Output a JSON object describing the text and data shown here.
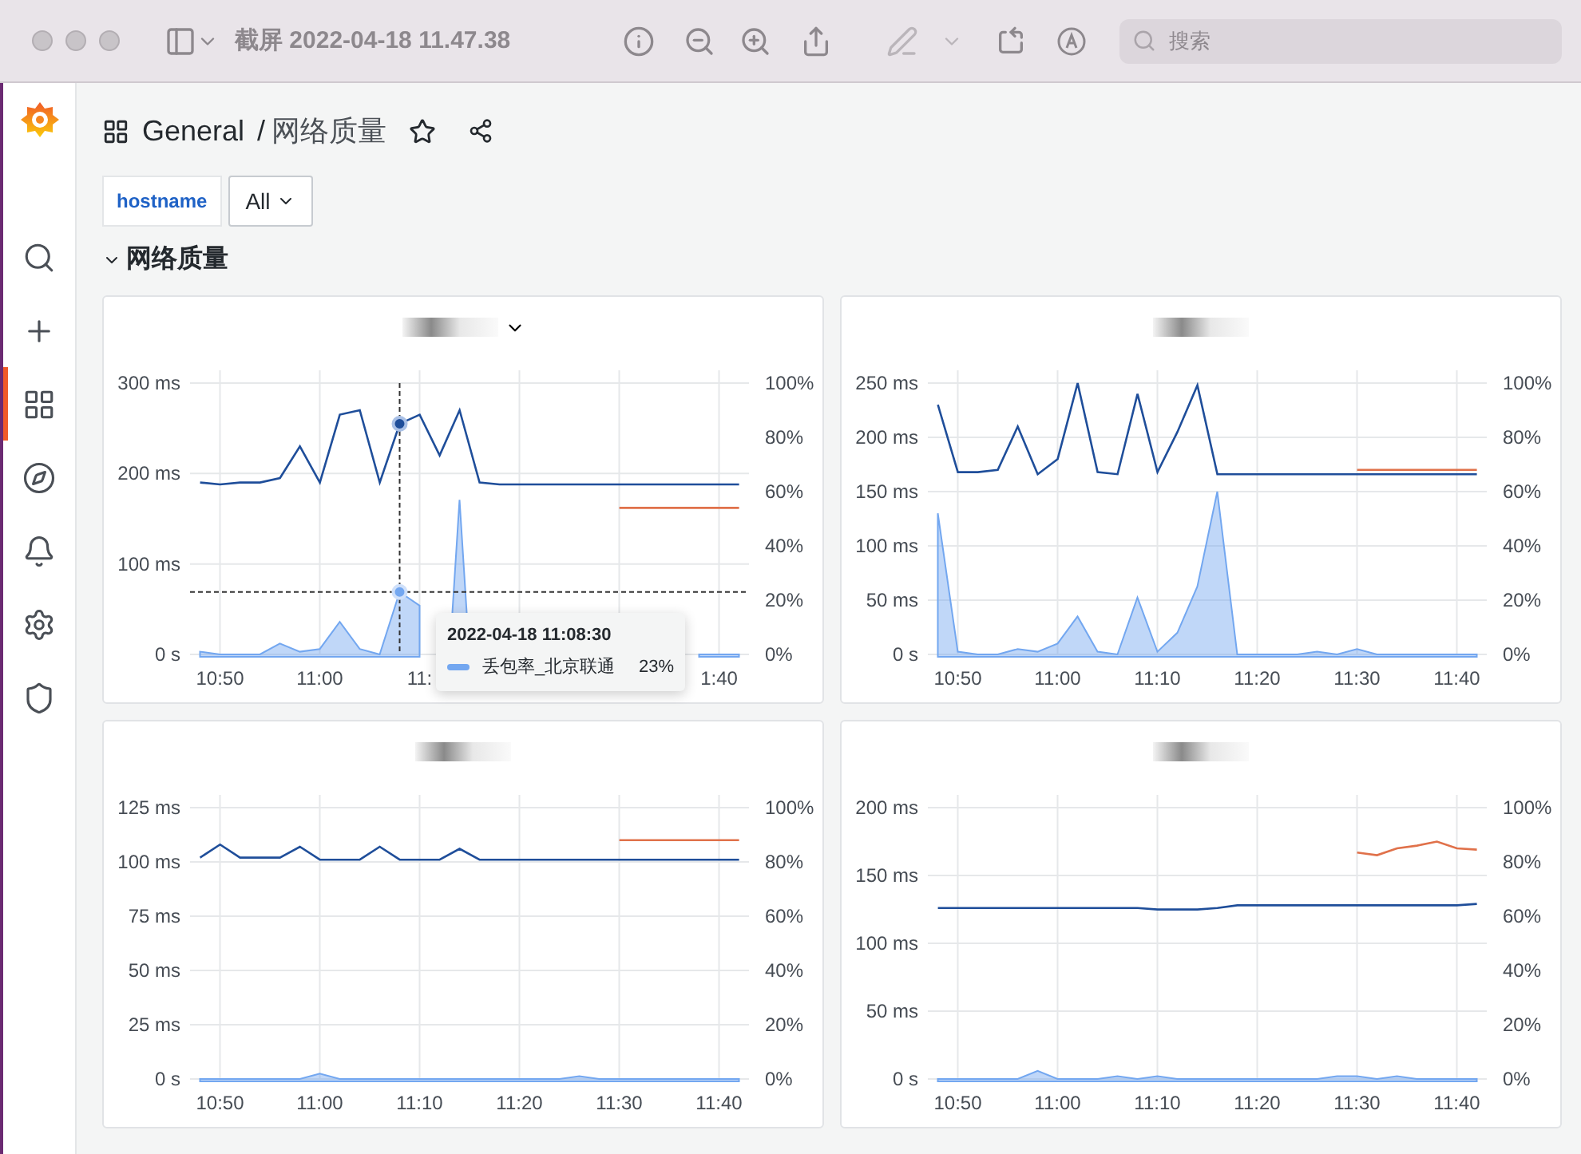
{
  "window": {
    "title": "截屏 2022-04-18 11.47.38",
    "search": {
      "placeholder": "搜索"
    }
  },
  "sidebar": {
    "items": [
      {
        "selected": false
      },
      {
        "selected": false
      },
      {
        "selected": true
      },
      {
        "selected": false
      },
      {
        "selected": false
      },
      {
        "selected": false
      },
      {
        "selected": false
      }
    ]
  },
  "breadcrumb": {
    "folder": "General",
    "separator": "/",
    "dashboard": "网络质量",
    "starred": false
  },
  "variables": [
    {
      "label": "hostname",
      "value": "All"
    }
  ],
  "row": {
    "title": "网络质量",
    "expanded": true
  },
  "panels": [
    {
      "hovered": true,
      "chart_data": {
        "type": "line",
        "x": [
          null,
          "10:50",
          null,
          null,
          null,
          null,
          "11:00",
          null,
          null,
          null,
          null,
          "11:",
          null,
          null,
          null,
          null,
          null,
          null,
          null,
          null,
          null,
          null,
          null,
          null,
          null,
          null,
          "1:40",
          null
        ],
        "ylim": [
          0,
          300
        ],
        "y2lim": [
          0,
          100
        ],
        "grid": true,
        "ref_lines": [
          {
            "axis": "y2",
            "value": 23
          }
        ],
        "yticks": [
          {
            "value": 0,
            "label": "0 s"
          },
          {
            "value": 100,
            "label": "100 ms"
          },
          {
            "value": 200,
            "label": "200 ms"
          },
          {
            "value": 300,
            "label": "300 ms"
          }
        ],
        "y2ticks": [
          {
            "value": 0,
            "label": "0%"
          },
          {
            "value": 20,
            "label": "20%"
          },
          {
            "value": 40,
            "label": "40%"
          },
          {
            "value": 60,
            "label": "60%"
          },
          {
            "value": 80,
            "label": "80%"
          },
          {
            "value": 100,
            "label": "100%"
          }
        ],
        "series": [
          {
            "axis": "y2",
            "type": "area",
            "color": "#73a7f0",
            "values": [
              1,
              0,
              0,
              0,
              4,
              1,
              2,
              12,
              2,
              0,
              23,
              18,
              null,
              57,
              null,
              null,
              null,
              null,
              null,
              null,
              null,
              null,
              null,
              null,
              null,
              0,
              0,
              0
            ]
          },
          {
            "color": "#1f4e9a",
            "values": [
              190,
              188,
              190,
              190,
              195,
              230,
              190,
              265,
              270,
              190,
              255,
              265,
              220,
              270,
              190,
              188,
              188,
              188,
              188,
              188,
              188,
              188,
              188,
              188,
              188,
              188,
              188,
              188
            ]
          },
          {
            "color": "#e0714a",
            "values": [
              null,
              null,
              null,
              null,
              null,
              null,
              null,
              null,
              null,
              null,
              null,
              null,
              null,
              null,
              null,
              null,
              null,
              null,
              null,
              null,
              null,
              162,
              162,
              162,
              162,
              162,
              162,
              162
            ]
          }
        ]
      },
      "tooltip": {
        "time": "2022-04-18 11:08:30",
        "items": [
          {
            "name": "丢包率_北京联通",
            "value": "23%",
            "color": "#73a7f0"
          }
        ]
      }
    },
    {
      "hovered": false,
      "chart_data": {
        "type": "line",
        "x": [
          null,
          "10:50",
          null,
          null,
          null,
          null,
          "11:00",
          null,
          null,
          null,
          null,
          "11:10",
          null,
          null,
          null,
          null,
          "11:20",
          null,
          null,
          null,
          null,
          "11:30",
          null,
          null,
          null,
          null,
          "11:40",
          null
        ],
        "ylim": [
          0,
          250
        ],
        "y2lim": [
          0,
          100
        ],
        "grid": true,
        "yticks": [
          {
            "value": 0,
            "label": "0 s"
          },
          {
            "value": 50,
            "label": "50 ms"
          },
          {
            "value": 100,
            "label": "100 ms"
          },
          {
            "value": 150,
            "label": "150 ms"
          },
          {
            "value": 200,
            "label": "200 ms"
          },
          {
            "value": 250,
            "label": "250 ms"
          }
        ],
        "y2ticks": [
          {
            "value": 0,
            "label": "0%"
          },
          {
            "value": 20,
            "label": "20%"
          },
          {
            "value": 40,
            "label": "40%"
          },
          {
            "value": 60,
            "label": "60%"
          },
          {
            "value": 80,
            "label": "80%"
          },
          {
            "value": 100,
            "label": "100%"
          }
        ],
        "series": [
          {
            "axis": "y2",
            "type": "area",
            "color": "#73a7f0",
            "values": [
              52,
              1,
              0,
              0,
              2,
              1,
              4,
              14,
              1,
              0,
              21,
              1,
              8,
              25,
              60,
              0,
              0,
              0,
              0,
              1,
              0,
              2,
              0,
              0,
              0,
              0,
              0,
              0
            ]
          },
          {
            "color": "#1f4e9a",
            "values": [
              230,
              168,
              168,
              170,
              210,
              166,
              180,
              250,
              168,
              166,
              240,
              168,
              205,
              248,
              166,
              166,
              166,
              166,
              166,
              166,
              166,
              166,
              166,
              166,
              166,
              166,
              166,
              166
            ]
          },
          {
            "color": "#e0714a",
            "values": [
              null,
              null,
              null,
              null,
              null,
              null,
              null,
              null,
              null,
              null,
              null,
              null,
              null,
              null,
              null,
              null,
              null,
              null,
              null,
              null,
              null,
              170,
              170,
              170,
              170,
              170,
              170,
              170
            ]
          }
        ]
      }
    },
    {
      "hovered": false,
      "chart_data": {
        "type": "line",
        "x": [
          null,
          "10:50",
          null,
          null,
          null,
          null,
          "11:00",
          null,
          null,
          null,
          null,
          "11:10",
          null,
          null,
          null,
          null,
          "11:20",
          null,
          null,
          null,
          null,
          "11:30",
          null,
          null,
          null,
          null,
          "11:40",
          null
        ],
        "ylim": [
          0,
          125
        ],
        "y2lim": [
          0,
          100
        ],
        "grid": true,
        "yticks": [
          {
            "value": 0,
            "label": "0 s"
          },
          {
            "value": 25,
            "label": "25 ms"
          },
          {
            "value": 50,
            "label": "50 ms"
          },
          {
            "value": 75,
            "label": "75 ms"
          },
          {
            "value": 100,
            "label": "100 ms"
          },
          {
            "value": 125,
            "label": "125 ms"
          }
        ],
        "y2ticks": [
          {
            "value": 0,
            "label": "0%"
          },
          {
            "value": 20,
            "label": "20%"
          },
          {
            "value": 40,
            "label": "40%"
          },
          {
            "value": 60,
            "label": "60%"
          },
          {
            "value": 80,
            "label": "80%"
          },
          {
            "value": 100,
            "label": "100%"
          }
        ],
        "series": [
          {
            "axis": "y2",
            "type": "area",
            "color": "#73a7f0",
            "values": [
              0,
              0,
              0,
              0,
              0,
              0,
              2,
              0,
              0,
              0,
              0,
              0,
              0,
              0,
              0,
              0,
              0,
              0,
              0,
              1,
              0,
              0,
              0,
              0,
              0,
              0,
              0,
              0
            ]
          },
          {
            "color": "#1f4e9a",
            "values": [
              102,
              108,
              102,
              102,
              102,
              107,
              101,
              101,
              101,
              107,
              101,
              101,
              101,
              106,
              101,
              101,
              101,
              101,
              101,
              101,
              101,
              101,
              101,
              101,
              101,
              101,
              101,
              101
            ]
          },
          {
            "color": "#e0714a",
            "values": [
              null,
              null,
              null,
              null,
              null,
              null,
              null,
              null,
              null,
              null,
              null,
              null,
              null,
              null,
              null,
              null,
              null,
              null,
              null,
              null,
              null,
              110,
              110,
              110,
              110,
              110,
              110,
              110
            ]
          }
        ]
      }
    },
    {
      "hovered": false,
      "chart_data": {
        "type": "line",
        "x": [
          null,
          "10:50",
          null,
          null,
          null,
          null,
          "11:00",
          null,
          null,
          null,
          null,
          "11:10",
          null,
          null,
          null,
          null,
          "11:20",
          null,
          null,
          null,
          null,
          "11:30",
          null,
          null,
          null,
          null,
          "11:40",
          null
        ],
        "ylim": [
          0,
          200
        ],
        "y2lim": [
          0,
          100
        ],
        "grid": true,
        "yticks": [
          {
            "value": 0,
            "label": "0 s"
          },
          {
            "value": 50,
            "label": "50 ms"
          },
          {
            "value": 100,
            "label": "100 ms"
          },
          {
            "value": 150,
            "label": "150 ms"
          },
          {
            "value": 200,
            "label": "200 ms"
          }
        ],
        "y2ticks": [
          {
            "value": 0,
            "label": "0%"
          },
          {
            "value": 20,
            "label": "20%"
          },
          {
            "value": 40,
            "label": "40%"
          },
          {
            "value": 60,
            "label": "60%"
          },
          {
            "value": 80,
            "label": "80%"
          },
          {
            "value": 100,
            "label": "100%"
          }
        ],
        "series": [
          {
            "axis": "y2",
            "type": "area",
            "color": "#73a7f0",
            "values": [
              0,
              0,
              0,
              0,
              0,
              3,
              0,
              0,
              0,
              1,
              0,
              1,
              0,
              0,
              0,
              0,
              0,
              0,
              0,
              0,
              1,
              1,
              0,
              1,
              0,
              0,
              0,
              0
            ]
          },
          {
            "color": "#1f4e9a",
            "values": [
              126,
              126,
              126,
              126,
              126,
              126,
              126,
              126,
              126,
              126,
              126,
              125,
              125,
              125,
              126,
              128,
              128,
              128,
              128,
              128,
              128,
              128,
              128,
              128,
              128,
              128,
              128,
              129
            ]
          },
          {
            "color": "#e0714a",
            "values": [
              null,
              null,
              null,
              null,
              null,
              null,
              null,
              null,
              null,
              null,
              null,
              null,
              null,
              null,
              null,
              null,
              null,
              null,
              null,
              null,
              null,
              167,
              165,
              170,
              172,
              175,
              170,
              169
            ]
          }
        ]
      }
    }
  ]
}
